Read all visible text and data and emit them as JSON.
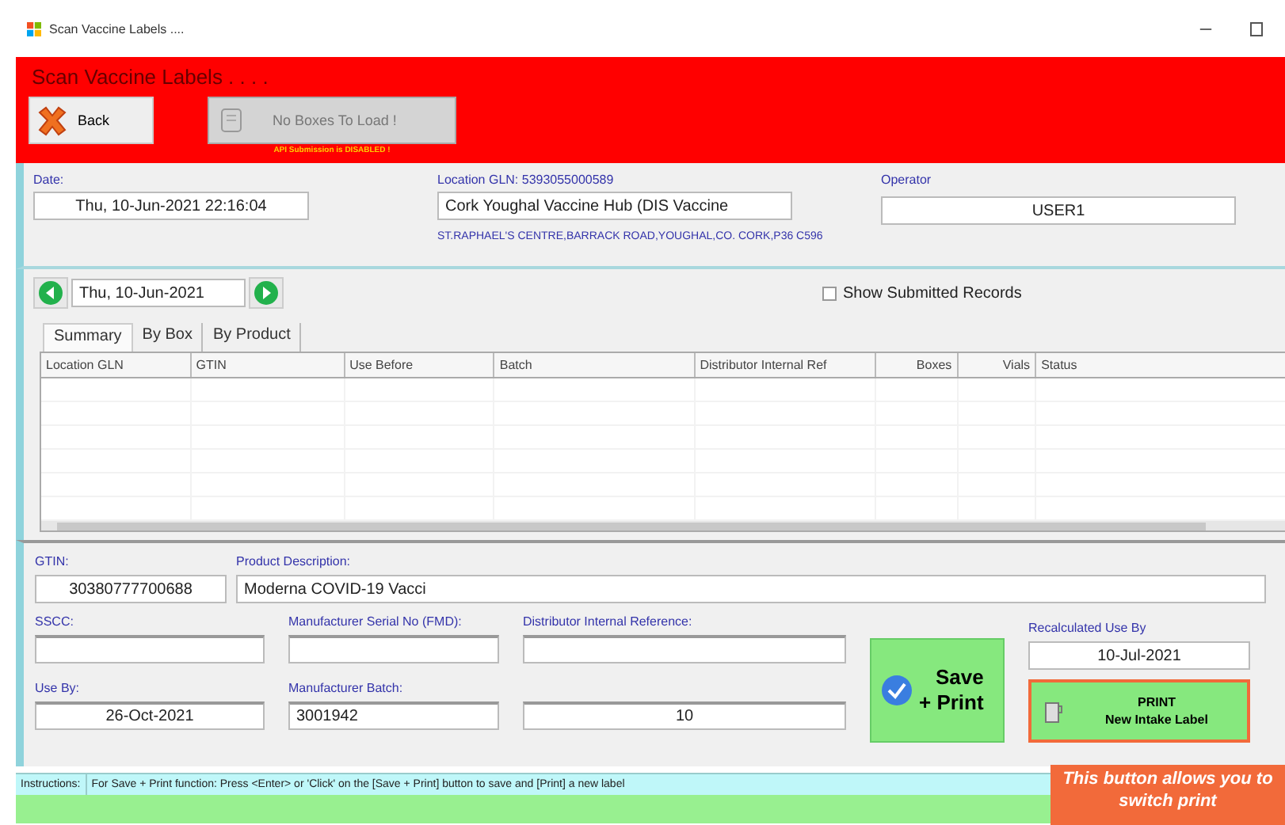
{
  "window": {
    "title": "Scan Vaccine Labels ...."
  },
  "header": {
    "title": "Scan Vaccine Labels . . . .",
    "back_button": "Back",
    "load_button": {
      "label": "No Boxes To Load !",
      "disabled": true
    },
    "notice": "API Submission is DISABLED !"
  },
  "info": {
    "date_label": "Date:",
    "date": "Thu, 10-Jun-2021 22:16:04",
    "location_label": "Location GLN: 5393055000589",
    "location": "Cork Youghal Vaccine Hub (DIS Vaccine",
    "address": "ST.RAPHAEL'S CENTRE,BARRACK ROAD,YOUGHAL,CO. CORK,P36 C596",
    "operator_label": "Operator",
    "operator": "USER1"
  },
  "day": {
    "date": "Thu, 10-Jun-2021",
    "show_submitted": {
      "label": "Show Submitted Records",
      "checked": false
    }
  },
  "tabs": [
    {
      "label": "Summary",
      "selected": true
    },
    {
      "label": "By Box",
      "selected": false
    },
    {
      "label": "By Product",
      "selected": false
    }
  ],
  "table": {
    "columns": [
      "Location GLN",
      "GTIN",
      "Use Before",
      "Batch",
      "Distributor Internal Ref",
      "Boxes",
      "Vials",
      "Status"
    ]
  },
  "form": {
    "gtin_label": "GTIN:",
    "gtin": "30380777700688",
    "description_label": "Product Description:",
    "description": "Moderna COVID-19 Vacci",
    "fields": [
      {
        "label": "SSCC:"
      },
      {
        "label": "Manufacturer Serial No (FMD):"
      },
      {
        "label": "Distributor Internal Reference:"
      },
      {
        "label": "Use By:",
        "value": "26-Oct-2021"
      },
      {
        "label": "Manufacturer Batch:",
        "value": "3001942"
      },
      {
        "value": "10"
      }
    ],
    "save_button": "Save\n+ Print",
    "recalc_label": "Recalculated Use By",
    "recalc": "10-Jul-2021",
    "print_button": "PRINT\nNew Intake Label"
  },
  "status_bar": {
    "label": "Instructions:",
    "text": "For Save + Print function:  Press <Enter> or 'Click' on the [Save + Print] button to save and [Print] a new label"
  },
  "callout": "This button allows you to switch print"
}
